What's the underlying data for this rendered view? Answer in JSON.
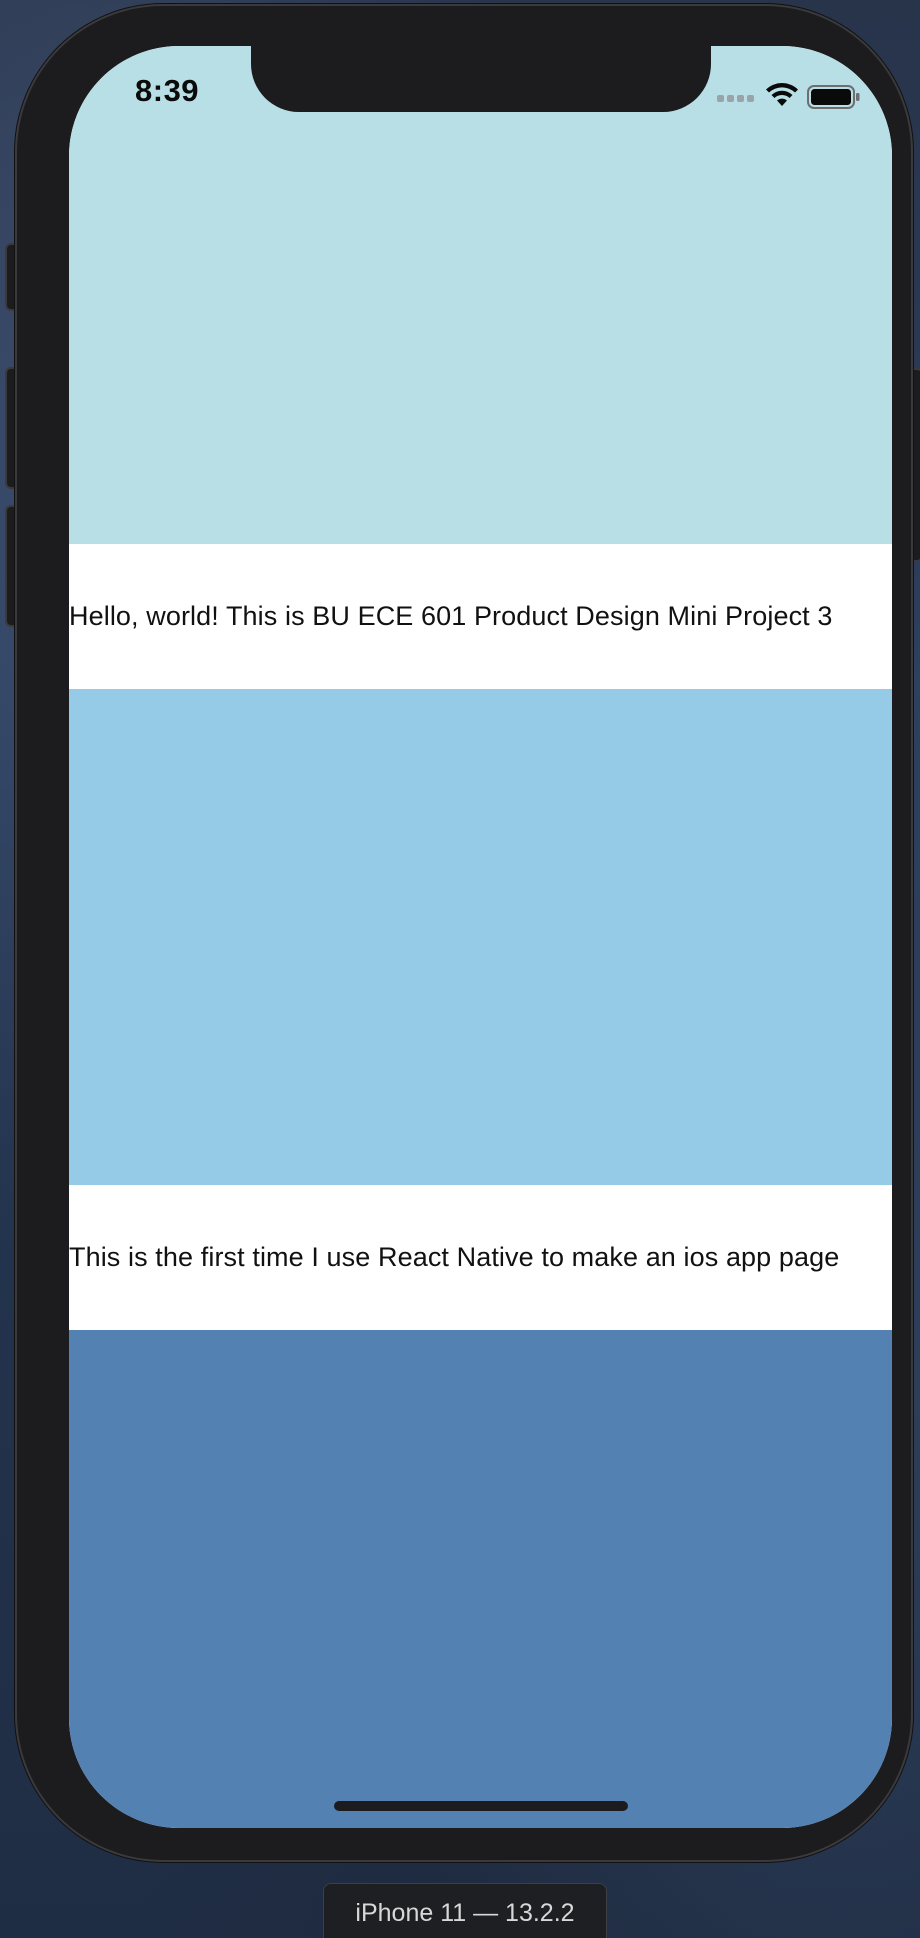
{
  "status_bar": {
    "time": "8:39"
  },
  "screen": {
    "blocks": [
      {
        "color": "#b8dfe5"
      },
      {
        "color": "#96cbe8"
      },
      {
        "color": "#5381b2"
      }
    ],
    "texts": [
      "Hello, world! This is BU ECE 601 Product Design Mini Project 3",
      "This is the first time I use React Native to make an ios app page"
    ]
  },
  "device": {
    "label": "iPhone 11 — 13.2.2"
  },
  "icons": {
    "signal": "cellular-signal-icon",
    "wifi": "wifi-icon",
    "battery": "battery-icon"
  }
}
